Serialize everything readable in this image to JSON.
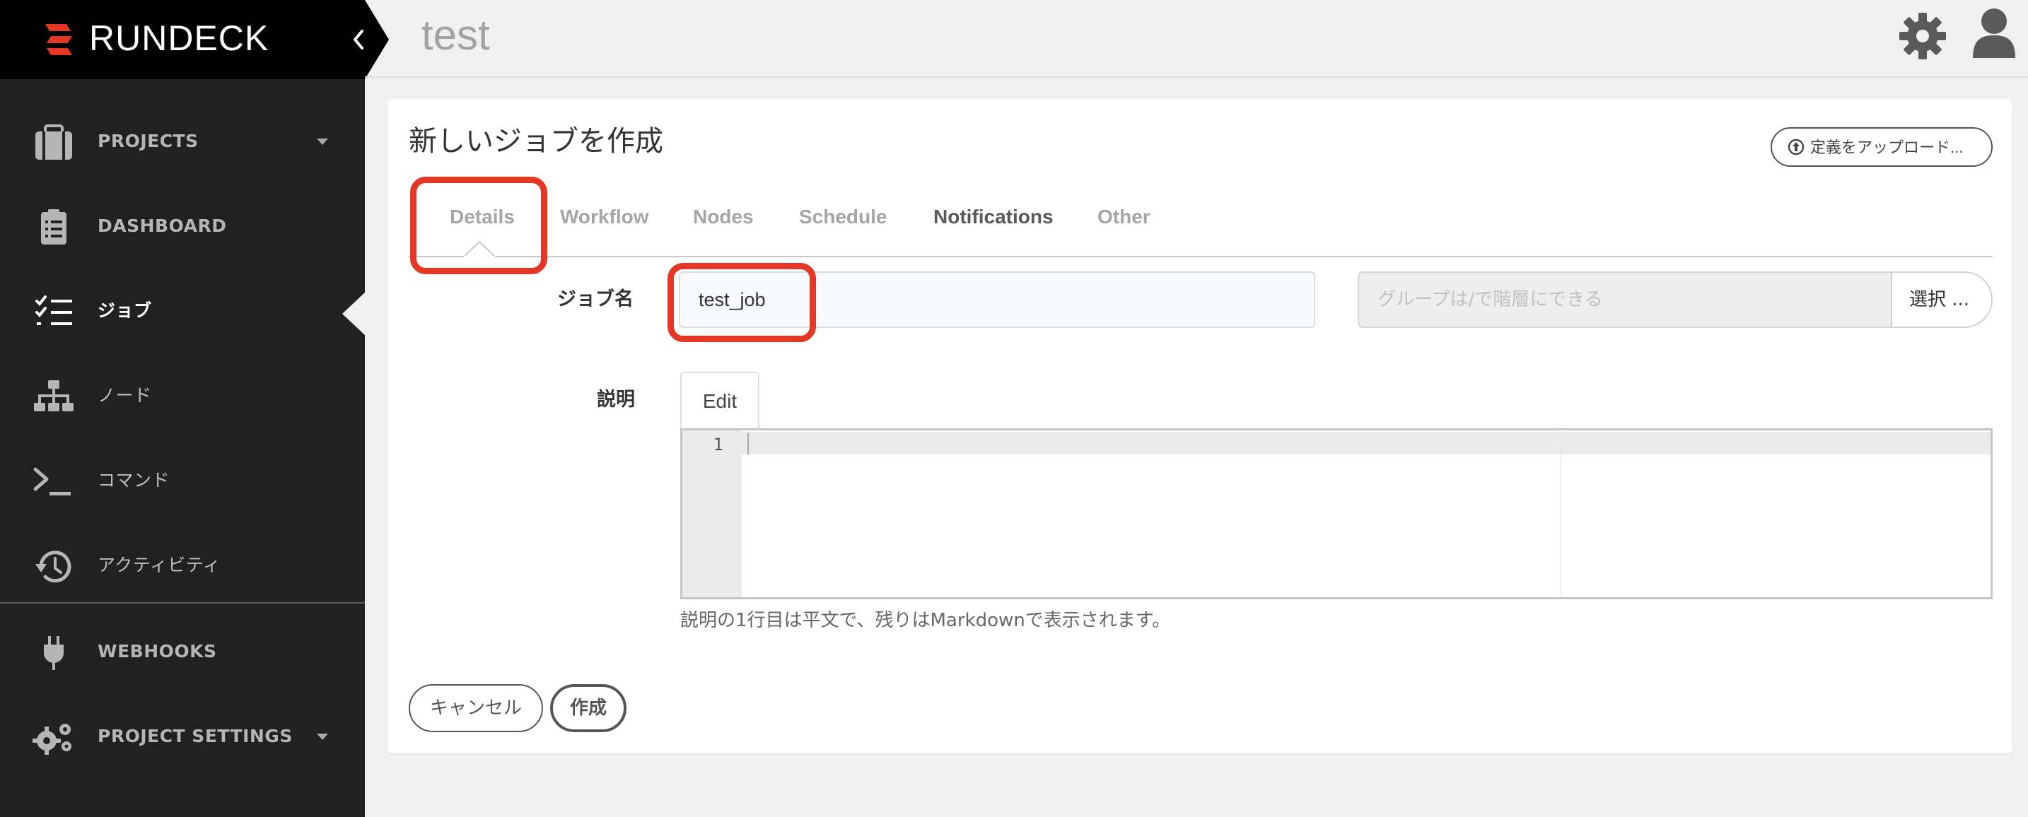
{
  "app": {
    "brand_name": "RUNDECK",
    "brand_color": "#e43725",
    "project_name": "test"
  },
  "sidebar": {
    "items": [
      {
        "label": "PROJECTS",
        "icon": "briefcase-icon",
        "has_dropdown": true
      },
      {
        "label": "DASHBOARD",
        "icon": "clipboard-icon"
      },
      {
        "label": "ジョブ",
        "icon": "checklist-icon",
        "active": true
      },
      {
        "label": "ノード",
        "icon": "sitemap-icon"
      },
      {
        "label": "コマンド",
        "icon": "terminal-icon"
      },
      {
        "label": "アクティビティ",
        "icon": "history-icon"
      },
      {
        "label": "WEBHOOKS",
        "icon": "plug-icon"
      },
      {
        "label": "PROJECT SETTINGS",
        "icon": "gears-icon",
        "has_dropdown": true
      }
    ]
  },
  "header": {
    "settings_icon": "gear-icon",
    "user_icon": "user-icon"
  },
  "main": {
    "title": "新しいジョブを作成",
    "upload_button": "定義をアップロード...",
    "tabs": [
      {
        "label": "Details",
        "active": true
      },
      {
        "label": "Workflow"
      },
      {
        "label": "Nodes"
      },
      {
        "label": "Schedule"
      },
      {
        "label": "Notifications"
      },
      {
        "label": "Other"
      }
    ],
    "form": {
      "job_name_label": "ジョブ名",
      "job_name_value": "test_job",
      "group_placeholder": "グループは/で階層にできる",
      "select_button": "選択 ...",
      "description_label": "説明",
      "editor_tab": "Edit",
      "line_number": "1",
      "help_text": "説明の1行目は平文で、残りはMarkdownで表示されます。"
    },
    "actions": {
      "cancel": "キャンセル",
      "create": "作成"
    }
  },
  "highlight_color": "#e43725"
}
